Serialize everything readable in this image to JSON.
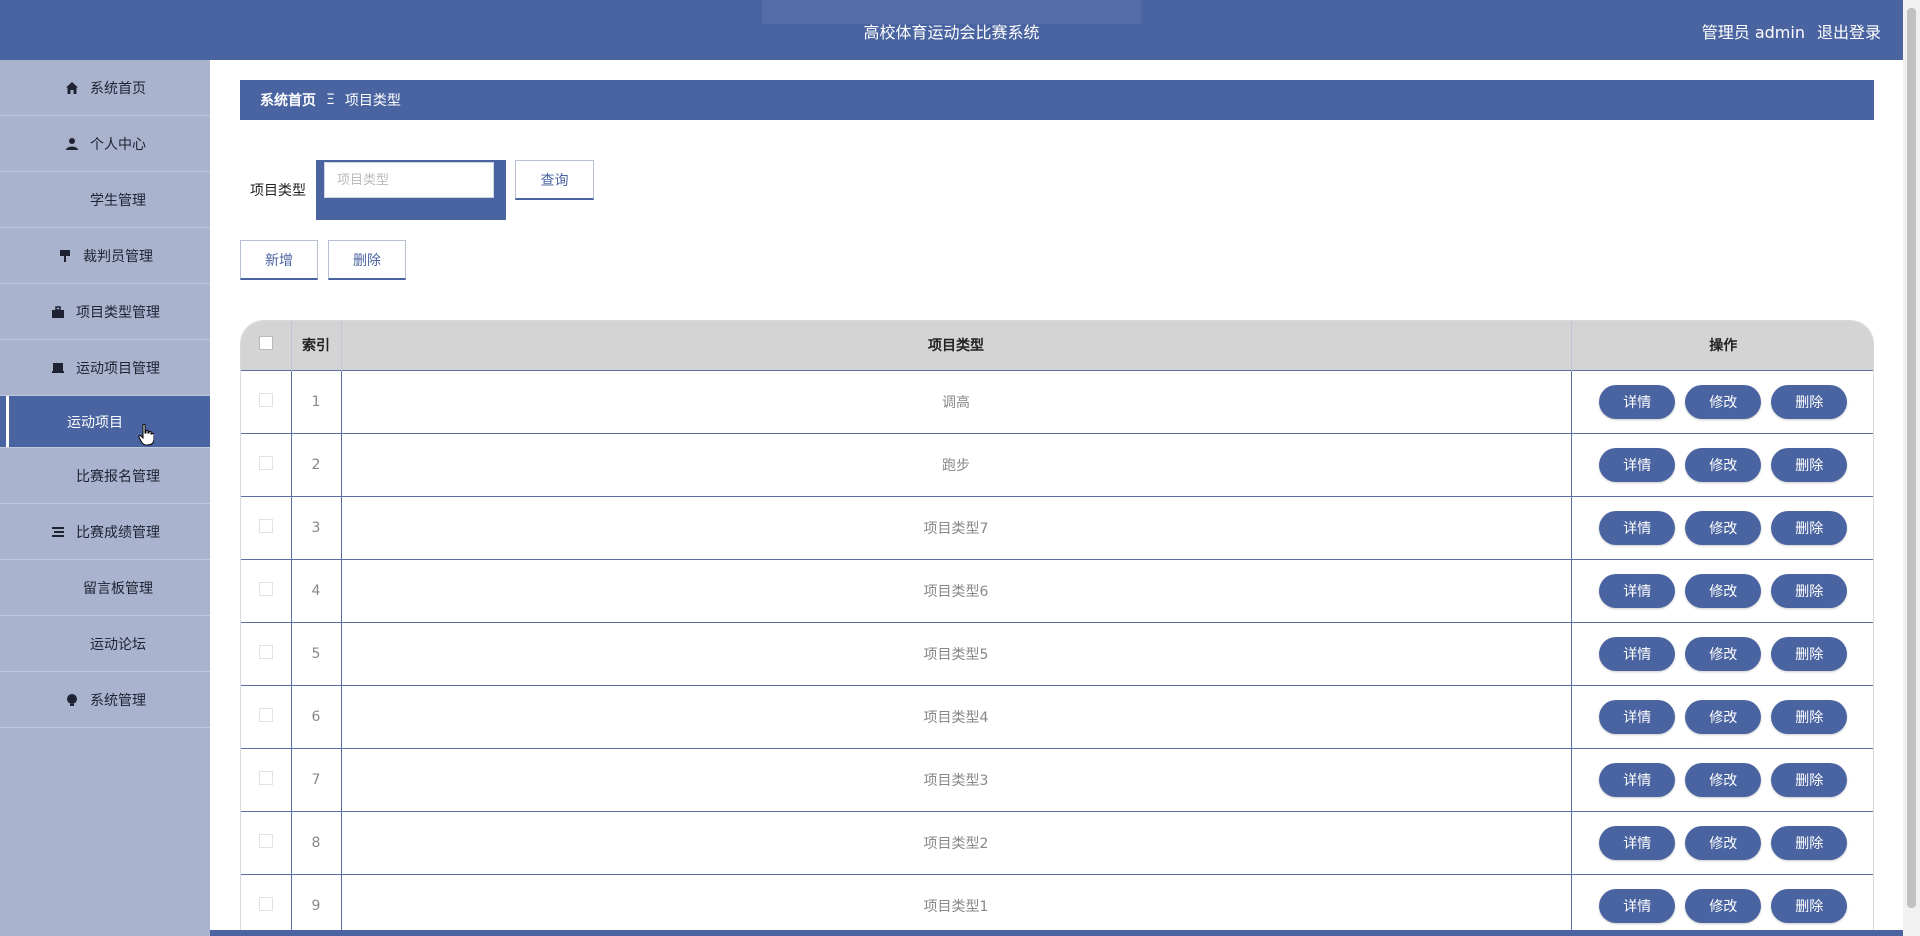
{
  "header": {
    "title": "高校体育运动会比赛系统",
    "role": "管理员 admin",
    "logout": "退出登录"
  },
  "sidebar": {
    "items": [
      {
        "label": "系统首页",
        "icon": "home-icon"
      },
      {
        "label": "个人中心",
        "icon": "user-icon"
      },
      {
        "label": "学生管理",
        "icon": "grid-icon"
      },
      {
        "label": "裁判员管理",
        "icon": "stamp-icon"
      },
      {
        "label": "项目类型管理",
        "icon": "briefcase-icon"
      },
      {
        "label": "运动项目管理",
        "icon": "printer-icon"
      },
      {
        "label": "运动项目",
        "icon": "",
        "active": true
      },
      {
        "label": "比赛报名管理",
        "icon": "grid-icon"
      },
      {
        "label": "比赛成绩管理",
        "icon": "list-icon"
      },
      {
        "label": "留言板管理",
        "icon": "grid-icon"
      },
      {
        "label": "运动论坛",
        "icon": "grid-icon"
      },
      {
        "label": "系统管理",
        "icon": "bulb-icon"
      }
    ]
  },
  "breadcrumb": {
    "home": "系统首页",
    "separator": "Ξ",
    "current": "项目类型"
  },
  "search": {
    "label": "项目类型",
    "placeholder": "项目类型",
    "button": "查询"
  },
  "actions": {
    "add": "新增",
    "delete": "删除"
  },
  "table": {
    "columns": {
      "index": "索引",
      "type": "项目类型",
      "ops": "操作"
    },
    "rows": [
      {
        "index": "1",
        "type": "调高"
      },
      {
        "index": "2",
        "type": "跑步"
      },
      {
        "index": "3",
        "type": "项目类型7"
      },
      {
        "index": "4",
        "type": "项目类型6"
      },
      {
        "index": "5",
        "type": "项目类型5"
      },
      {
        "index": "6",
        "type": "项目类型4"
      },
      {
        "index": "7",
        "type": "项目类型3"
      },
      {
        "index": "8",
        "type": "项目类型2"
      },
      {
        "index": "9",
        "type": "项目类型1"
      }
    ],
    "row_buttons": {
      "detail": "详情",
      "edit": "修改",
      "delete": "删除"
    }
  },
  "colors": {
    "primary": "#4a64a1",
    "sidebar": "#a9b3cd",
    "header_row": "#d4d4d4"
  }
}
